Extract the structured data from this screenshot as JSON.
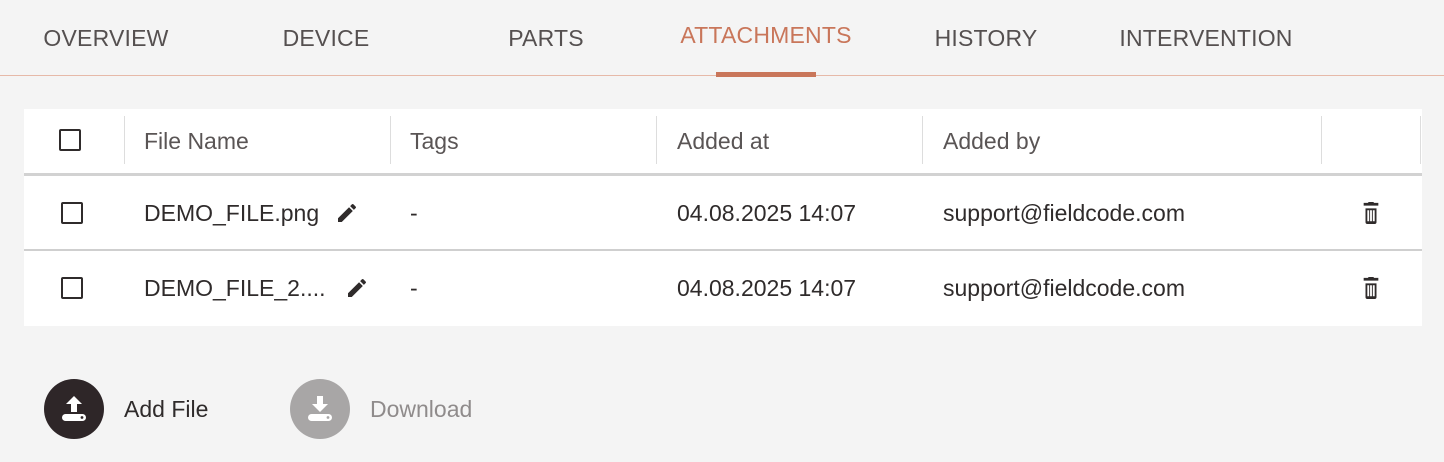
{
  "tabs": [
    {
      "label": "OVERVIEW",
      "active": false
    },
    {
      "label": "DEVICE",
      "active": false
    },
    {
      "label": "PARTS",
      "active": false
    },
    {
      "label": "ATTACHMENTS",
      "active": true
    },
    {
      "label": "HISTORY",
      "active": false
    },
    {
      "label": "INTERVENTION",
      "active": false
    }
  ],
  "table": {
    "columns": {
      "file_name": "File Name",
      "tags": "Tags",
      "added_at": "Added at",
      "added_by": "Added by"
    },
    "rows": [
      {
        "file_name": "DEMO_FILE.png",
        "tags": "-",
        "added_at": "04.08.2025 14:07",
        "added_by": "support@fieldcode.com"
      },
      {
        "file_name": "DEMO_FILE_2....",
        "tags": "-",
        "added_at": "04.08.2025 14:07",
        "added_by": "support@fieldcode.com"
      }
    ]
  },
  "actions": {
    "add_file": "Add File",
    "download": "Download"
  },
  "icons": {
    "edit": "pencil-icon",
    "delete": "trash-icon",
    "upload": "upload-icon",
    "download": "download-icon"
  },
  "colors": {
    "accent": "#c9765a",
    "primary_button": "#2e2628",
    "disabled_button": "#a8a6a6"
  }
}
